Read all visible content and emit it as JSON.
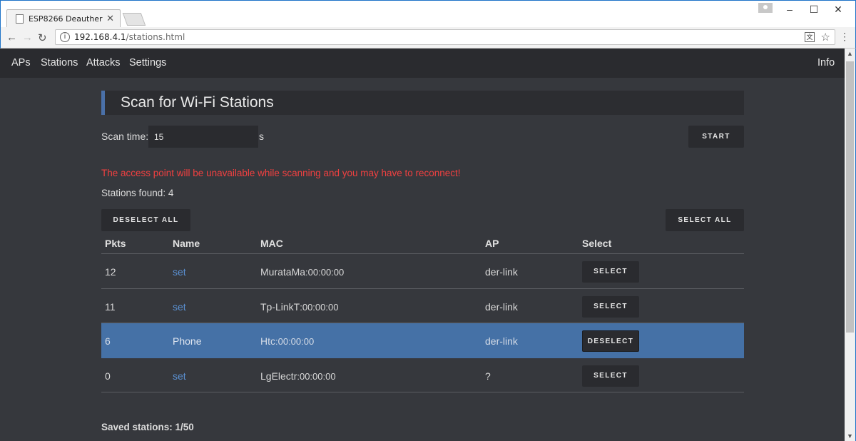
{
  "browser": {
    "tab_title": "ESP8266 Deauther",
    "tab_close": "✕",
    "url_host": "192.168.4.1",
    "url_path": "/stations.html",
    "window_controls": [
      "–",
      "☐",
      "✕"
    ]
  },
  "nav": {
    "links": [
      "APs",
      "Stations",
      "Attacks",
      "Settings"
    ],
    "info": "Info"
  },
  "page": {
    "title": "Scan for Wi-Fi Stations",
    "scan_label": "Scan time:",
    "scan_value": "15",
    "scan_unit": "s",
    "start_button": "START",
    "warning": "The access point will be unavailable while scanning and you may have to reconnect!",
    "found_text": "Stations found: 4",
    "deselect_all": "DESELECT ALL",
    "select_all": "SELECT ALL",
    "saved_text": "Saved stations: 1/50"
  },
  "table": {
    "headers": [
      "Pkts",
      "Name",
      "MAC",
      "AP",
      "Select"
    ],
    "rows": [
      {
        "pkts": "12",
        "name": "set",
        "vendor": "MurataMa",
        "mac_suffix": ":00:00:00",
        "ap": "der-link",
        "button": "SELECT",
        "selected": false
      },
      {
        "pkts": "11",
        "name": "set",
        "vendor": "Tp-LinkT",
        "mac_suffix": ":00:00:00",
        "ap": "der-link",
        "button": "SELECT",
        "selected": false
      },
      {
        "pkts": "6",
        "name": "Phone",
        "vendor": "Htc",
        "mac_suffix": ":00:00:00",
        "ap": "der-link",
        "button": "DESELECT",
        "selected": true
      },
      {
        "pkts": "0",
        "name": "set",
        "vendor": "LgElectr",
        "mac_suffix": ":00:00:00",
        "ap": "?",
        "button": "SELECT",
        "selected": false
      }
    ]
  },
  "colors": {
    "background": "#36383d",
    "navbar": "#2a2b2f",
    "accent": "#4a70a8",
    "selected_row": "#4571a6",
    "warning": "#f04040",
    "link": "#5a8fd0"
  }
}
